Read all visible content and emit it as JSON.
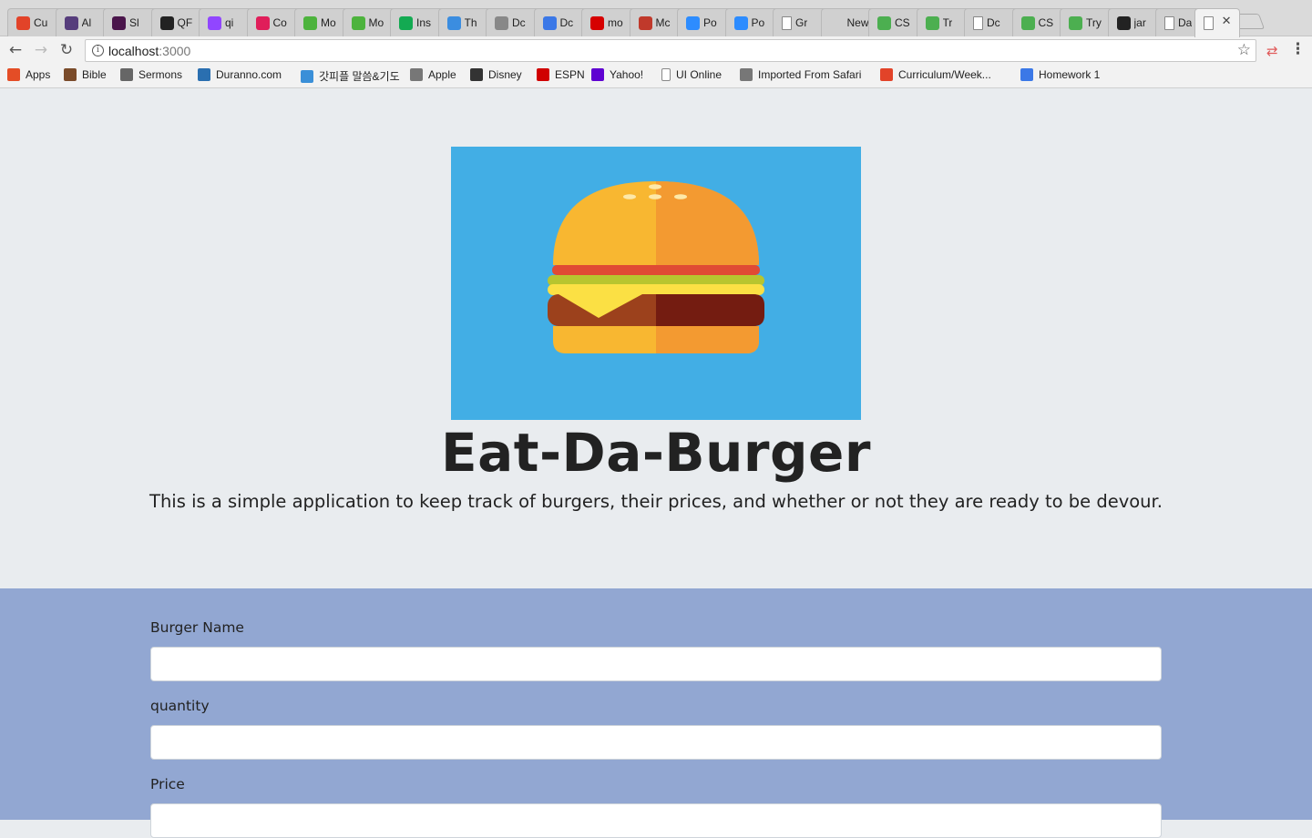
{
  "browser": {
    "tabs": [
      {
        "icon": "gitlab-icon",
        "title": "Cu",
        "color": "#e24329",
        "glyph": "🦊"
      },
      {
        "icon": "bootstrap-icon",
        "title": "Al",
        "color": "#563d7c",
        "glyph": "B"
      },
      {
        "icon": "slack-icon",
        "title": "Sl",
        "color": "#4a154b",
        "glyph": "#"
      },
      {
        "icon": "github-icon",
        "title": "QF",
        "color": "#222222",
        "glyph": "●"
      },
      {
        "icon": "twitch-icon",
        "title": "qi",
        "color": "#9146ff",
        "glyph": "▣"
      },
      {
        "icon": "slack-color-icon",
        "title": "Co",
        "color": "#e01e5a",
        "glyph": "✱"
      },
      {
        "icon": "mongodb-icon",
        "title": "Mo",
        "color": "#4db33d",
        "glyph": "❦"
      },
      {
        "icon": "mongodb-icon",
        "title": "Mo",
        "color": "#4db33d",
        "glyph": "❦"
      },
      {
        "icon": "mongodb-dark-icon",
        "title": "Ins",
        "color": "#13aa52",
        "glyph": "❦"
      },
      {
        "icon": "loading-icon",
        "title": "Th",
        "color": "#3b8de0",
        "glyph": "◔"
      },
      {
        "icon": "apple-icon",
        "title": "Dc",
        "color": "#888888",
        "glyph": ""
      },
      {
        "icon": "download-icon",
        "title": "Dc",
        "color": "#3b78e7",
        "glyph": "↓"
      },
      {
        "icon": "m-red-icon",
        "title": "mo",
        "color": "#d60000",
        "glyph": "n"
      },
      {
        "icon": "m-outline-icon",
        "title": "Mc",
        "color": "#c0392b",
        "glyph": "m"
      },
      {
        "icon": "zoom-icon",
        "title": "Po",
        "color": "#2d8cff",
        "glyph": "▶"
      },
      {
        "icon": "zoom-icon",
        "title": "Po",
        "color": "#2d8cff",
        "glyph": "▶"
      },
      {
        "icon": "doc-icon",
        "title": "Gr",
        "color": "#ffffff",
        "glyph": "▯"
      },
      {
        "icon": "blank-icon",
        "title": "New T",
        "color": "transparent",
        "glyph": ""
      },
      {
        "icon": "w3-icon",
        "title": "CS",
        "color": "#4caf50",
        "glyph": "w3"
      },
      {
        "icon": "w3-icon",
        "title": "Tr",
        "color": "#4caf50",
        "glyph": "w3"
      },
      {
        "icon": "doc-icon",
        "title": "Dc",
        "color": "#ffffff",
        "glyph": "▯"
      },
      {
        "icon": "w3-icon",
        "title": "CS",
        "color": "#4caf50",
        "glyph": "w3"
      },
      {
        "icon": "w3-icon",
        "title": "Try",
        "color": "#4caf50",
        "glyph": "w3"
      },
      {
        "icon": "github-icon",
        "title": "jar",
        "color": "#222222",
        "glyph": "●"
      },
      {
        "icon": "doc-icon",
        "title": "Da",
        "color": "#ffffff",
        "glyph": "▯"
      },
      {
        "icon": "doc-icon",
        "title": "",
        "color": "#ffffff",
        "glyph": "▯",
        "active": true
      }
    ],
    "url_host": "localhost",
    "url_port": ":3000",
    "bookmarks": [
      {
        "icon": "apps-grid-icon",
        "label": "Apps",
        "color": "#e44d26"
      },
      {
        "icon": "bible-icon",
        "label": "Bible",
        "color": "#7a4b2a"
      },
      {
        "icon": "sermons-icon",
        "label": "Sermons",
        "color": "#666666"
      },
      {
        "icon": "duranno-icon",
        "label": "Duranno.com",
        "color": "#2a6fb0"
      },
      {
        "icon": "p-icon",
        "label": "갓피플 말씀&기도",
        "color": "#3a8fd8"
      },
      {
        "icon": "apple-icon",
        "label": "Apple",
        "color": "#777777"
      },
      {
        "icon": "disney-icon",
        "label": "Disney",
        "color": "#333333"
      },
      {
        "icon": "espn-icon",
        "label": "ESPN",
        "color": "#d00000"
      },
      {
        "icon": "yahoo-icon",
        "label": "Yahoo!",
        "color": "#5f01d1"
      },
      {
        "icon": "page-icon",
        "label": "UI Online",
        "color": "#ffffff"
      },
      {
        "icon": "folder-icon",
        "label": "Imported From Safari",
        "color": "#777777"
      },
      {
        "icon": "gitlab-icon",
        "label": "Curriculum/Week...",
        "color": "#e24329"
      },
      {
        "icon": "homework-icon",
        "label": "Homework 1",
        "color": "#3b78e7"
      }
    ]
  },
  "page": {
    "title": "Eat-Da-Burger",
    "lead": "This is a simple application to keep track of burgers, their prices, and whether or not they are ready to be devour.",
    "form": {
      "fields": [
        {
          "label": "Burger Name",
          "value": ""
        },
        {
          "label": "quantity",
          "value": ""
        },
        {
          "label": "Price",
          "value": ""
        }
      ]
    }
  },
  "colors": {
    "hero_bg": "#42aee5",
    "jumbotron_bg": "#e9ecef",
    "form_bg": "#92a7d2"
  }
}
